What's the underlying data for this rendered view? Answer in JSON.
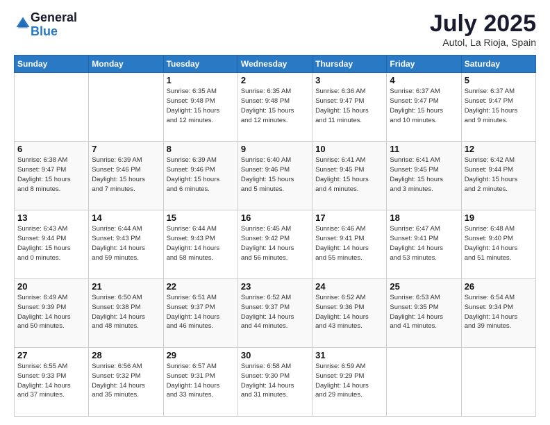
{
  "header": {
    "logo_general": "General",
    "logo_blue": "Blue",
    "month_title": "July 2025",
    "location": "Autol, La Rioja, Spain"
  },
  "days_of_week": [
    "Sunday",
    "Monday",
    "Tuesday",
    "Wednesday",
    "Thursday",
    "Friday",
    "Saturday"
  ],
  "weeks": [
    [
      {
        "day": "",
        "info": ""
      },
      {
        "day": "",
        "info": ""
      },
      {
        "day": "1",
        "info": "Sunrise: 6:35 AM\nSunset: 9:48 PM\nDaylight: 15 hours\nand 12 minutes."
      },
      {
        "day": "2",
        "info": "Sunrise: 6:35 AM\nSunset: 9:48 PM\nDaylight: 15 hours\nand 12 minutes."
      },
      {
        "day": "3",
        "info": "Sunrise: 6:36 AM\nSunset: 9:47 PM\nDaylight: 15 hours\nand 11 minutes."
      },
      {
        "day": "4",
        "info": "Sunrise: 6:37 AM\nSunset: 9:47 PM\nDaylight: 15 hours\nand 10 minutes."
      },
      {
        "day": "5",
        "info": "Sunrise: 6:37 AM\nSunset: 9:47 PM\nDaylight: 15 hours\nand 9 minutes."
      }
    ],
    [
      {
        "day": "6",
        "info": "Sunrise: 6:38 AM\nSunset: 9:47 PM\nDaylight: 15 hours\nand 8 minutes."
      },
      {
        "day": "7",
        "info": "Sunrise: 6:39 AM\nSunset: 9:46 PM\nDaylight: 15 hours\nand 7 minutes."
      },
      {
        "day": "8",
        "info": "Sunrise: 6:39 AM\nSunset: 9:46 PM\nDaylight: 15 hours\nand 6 minutes."
      },
      {
        "day": "9",
        "info": "Sunrise: 6:40 AM\nSunset: 9:46 PM\nDaylight: 15 hours\nand 5 minutes."
      },
      {
        "day": "10",
        "info": "Sunrise: 6:41 AM\nSunset: 9:45 PM\nDaylight: 15 hours\nand 4 minutes."
      },
      {
        "day": "11",
        "info": "Sunrise: 6:41 AM\nSunset: 9:45 PM\nDaylight: 15 hours\nand 3 minutes."
      },
      {
        "day": "12",
        "info": "Sunrise: 6:42 AM\nSunset: 9:44 PM\nDaylight: 15 hours\nand 2 minutes."
      }
    ],
    [
      {
        "day": "13",
        "info": "Sunrise: 6:43 AM\nSunset: 9:44 PM\nDaylight: 15 hours\nand 0 minutes."
      },
      {
        "day": "14",
        "info": "Sunrise: 6:44 AM\nSunset: 9:43 PM\nDaylight: 14 hours\nand 59 minutes."
      },
      {
        "day": "15",
        "info": "Sunrise: 6:44 AM\nSunset: 9:43 PM\nDaylight: 14 hours\nand 58 minutes."
      },
      {
        "day": "16",
        "info": "Sunrise: 6:45 AM\nSunset: 9:42 PM\nDaylight: 14 hours\nand 56 minutes."
      },
      {
        "day": "17",
        "info": "Sunrise: 6:46 AM\nSunset: 9:41 PM\nDaylight: 14 hours\nand 55 minutes."
      },
      {
        "day": "18",
        "info": "Sunrise: 6:47 AM\nSunset: 9:41 PM\nDaylight: 14 hours\nand 53 minutes."
      },
      {
        "day": "19",
        "info": "Sunrise: 6:48 AM\nSunset: 9:40 PM\nDaylight: 14 hours\nand 51 minutes."
      }
    ],
    [
      {
        "day": "20",
        "info": "Sunrise: 6:49 AM\nSunset: 9:39 PM\nDaylight: 14 hours\nand 50 minutes."
      },
      {
        "day": "21",
        "info": "Sunrise: 6:50 AM\nSunset: 9:38 PM\nDaylight: 14 hours\nand 48 minutes."
      },
      {
        "day": "22",
        "info": "Sunrise: 6:51 AM\nSunset: 9:37 PM\nDaylight: 14 hours\nand 46 minutes."
      },
      {
        "day": "23",
        "info": "Sunrise: 6:52 AM\nSunset: 9:37 PM\nDaylight: 14 hours\nand 44 minutes."
      },
      {
        "day": "24",
        "info": "Sunrise: 6:52 AM\nSunset: 9:36 PM\nDaylight: 14 hours\nand 43 minutes."
      },
      {
        "day": "25",
        "info": "Sunrise: 6:53 AM\nSunset: 9:35 PM\nDaylight: 14 hours\nand 41 minutes."
      },
      {
        "day": "26",
        "info": "Sunrise: 6:54 AM\nSunset: 9:34 PM\nDaylight: 14 hours\nand 39 minutes."
      }
    ],
    [
      {
        "day": "27",
        "info": "Sunrise: 6:55 AM\nSunset: 9:33 PM\nDaylight: 14 hours\nand 37 minutes."
      },
      {
        "day": "28",
        "info": "Sunrise: 6:56 AM\nSunset: 9:32 PM\nDaylight: 14 hours\nand 35 minutes."
      },
      {
        "day": "29",
        "info": "Sunrise: 6:57 AM\nSunset: 9:31 PM\nDaylight: 14 hours\nand 33 minutes."
      },
      {
        "day": "30",
        "info": "Sunrise: 6:58 AM\nSunset: 9:30 PM\nDaylight: 14 hours\nand 31 minutes."
      },
      {
        "day": "31",
        "info": "Sunrise: 6:59 AM\nSunset: 9:29 PM\nDaylight: 14 hours\nand 29 minutes."
      },
      {
        "day": "",
        "info": ""
      },
      {
        "day": "",
        "info": ""
      }
    ]
  ]
}
